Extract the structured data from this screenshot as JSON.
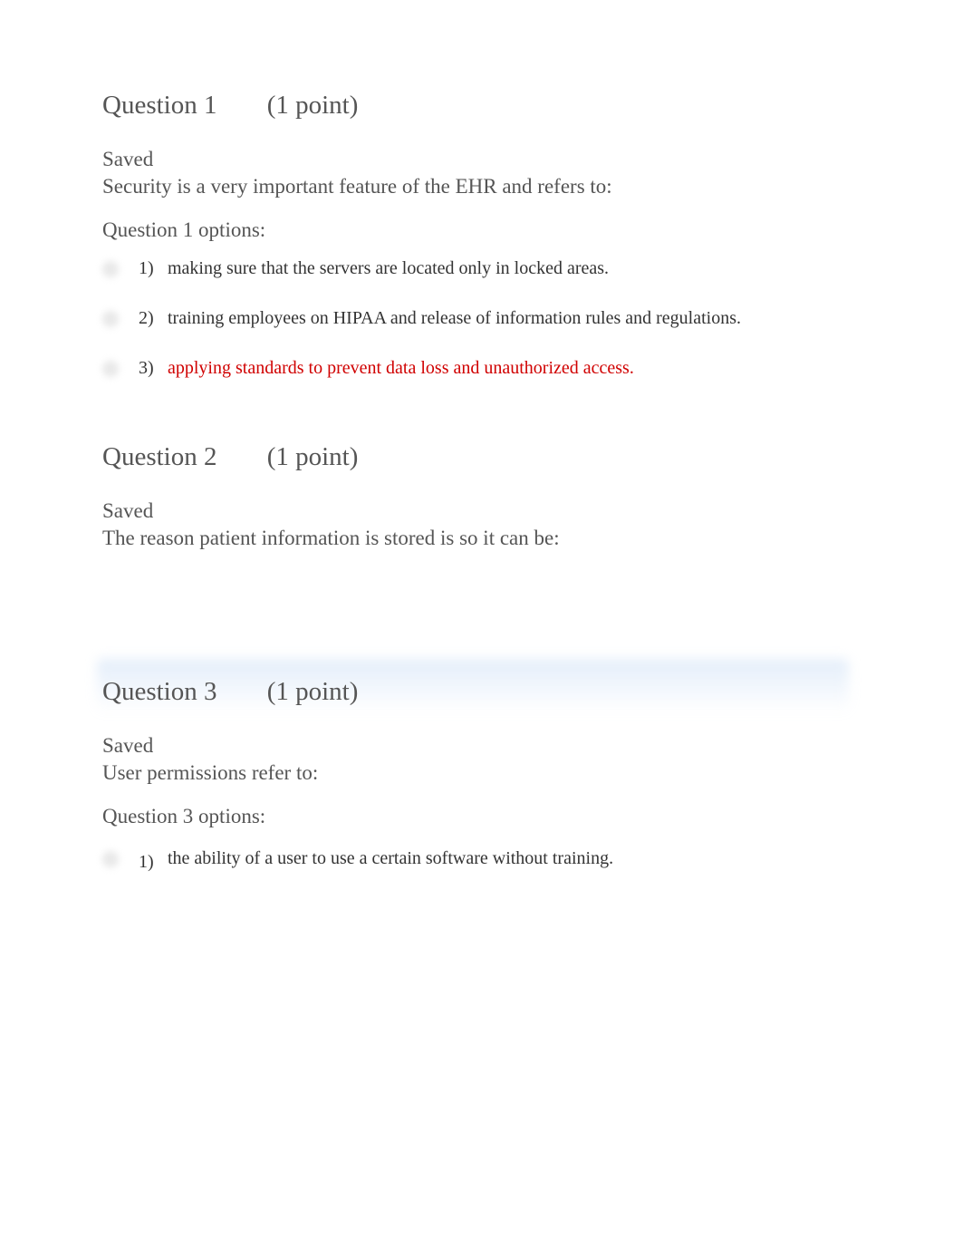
{
  "questions": [
    {
      "header_num": "Question 1",
      "header_points": "(1 point)",
      "status": "Saved",
      "prompt": "Security is a very important feature of the EHR and refers to:",
      "options_label": "Question 1 options:",
      "options": [
        {
          "num": "1)",
          "text": "making sure that the servers are located only in locked areas.",
          "highlight": false
        },
        {
          "num": "2)",
          "text": "training employees on HIPAA and release of information rules and regulations.",
          "highlight": false
        },
        {
          "num": "3)",
          "text": "applying standards to prevent data loss and unauthorized access.",
          "highlight": true
        }
      ]
    },
    {
      "header_num": "Question 2",
      "header_points": "(1 point)",
      "status": "Saved",
      "prompt": "The reason patient information is stored is so it can be:",
      "options_label": "",
      "options": []
    },
    {
      "header_num": "Question 3",
      "header_points": "(1 point)",
      "status": "Saved",
      "prompt": "User permissions refer to:",
      "options_label": "Question 3 options:",
      "options": [
        {
          "num": "1)",
          "text": "the ability of a user to use a certain software without training.",
          "highlight": false
        }
      ]
    }
  ]
}
